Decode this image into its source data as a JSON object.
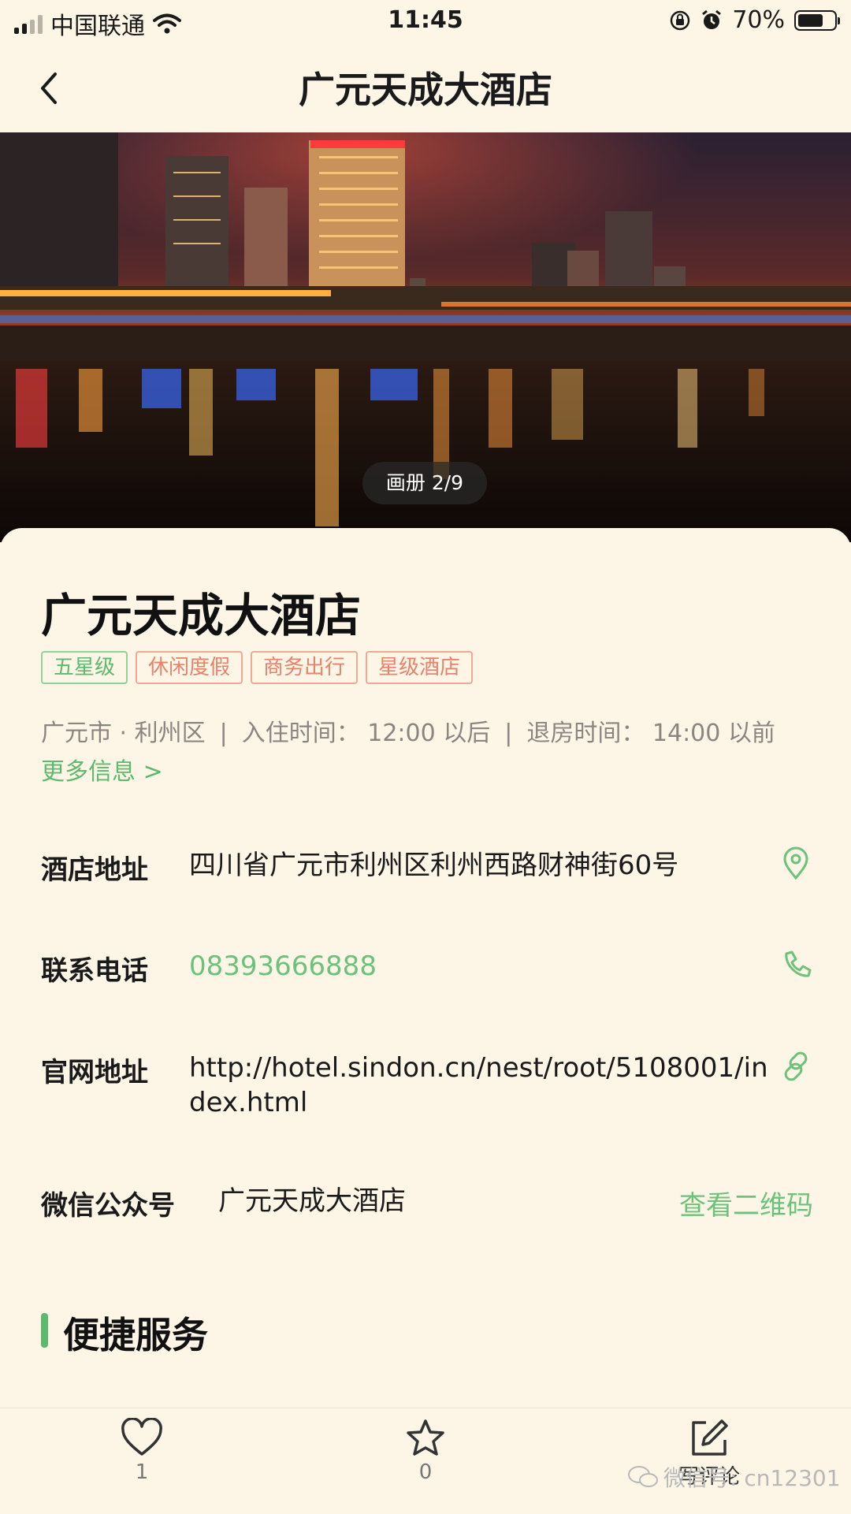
{
  "status_bar": {
    "carrier": "中国联通",
    "time": "11:45",
    "battery": "70%"
  },
  "nav": {
    "title": "广元天成大酒店"
  },
  "gallery": {
    "badge": "画册 2/9"
  },
  "hotel": {
    "name": "广元天成大酒店",
    "tags": [
      "五星级",
      "休闲度假",
      "商务出行",
      "星级酒店"
    ],
    "location": "广元市 · 利州区",
    "separator": "|",
    "checkin": "入住时间： 12:00 以后",
    "checkout": "退房时间： 14:00 以前",
    "more": "更多信息 >"
  },
  "details": {
    "address_label": "酒店地址",
    "address_value": "四川省广元市利州区利州西路财神街60号",
    "phone_label": "联系电话",
    "phone_value": "08393666888",
    "website_label": "官网地址",
    "website_value": "http://hotel.sindon.cn/nest/root/5108001/index.html",
    "wechat_label": "微信公众号",
    "wechat_value": "广元天成大酒店",
    "wechat_qr": "查看二维码"
  },
  "section": {
    "title": "便捷服务"
  },
  "bottom_bar": {
    "like_count": "1",
    "favorite_count": "0",
    "comment_label": "写评论"
  },
  "watermark": "微信号: cn12301",
  "colors": {
    "background": "#fdf6e7",
    "accent_green": "#5cba6c",
    "tag_red": "#e8826a"
  }
}
